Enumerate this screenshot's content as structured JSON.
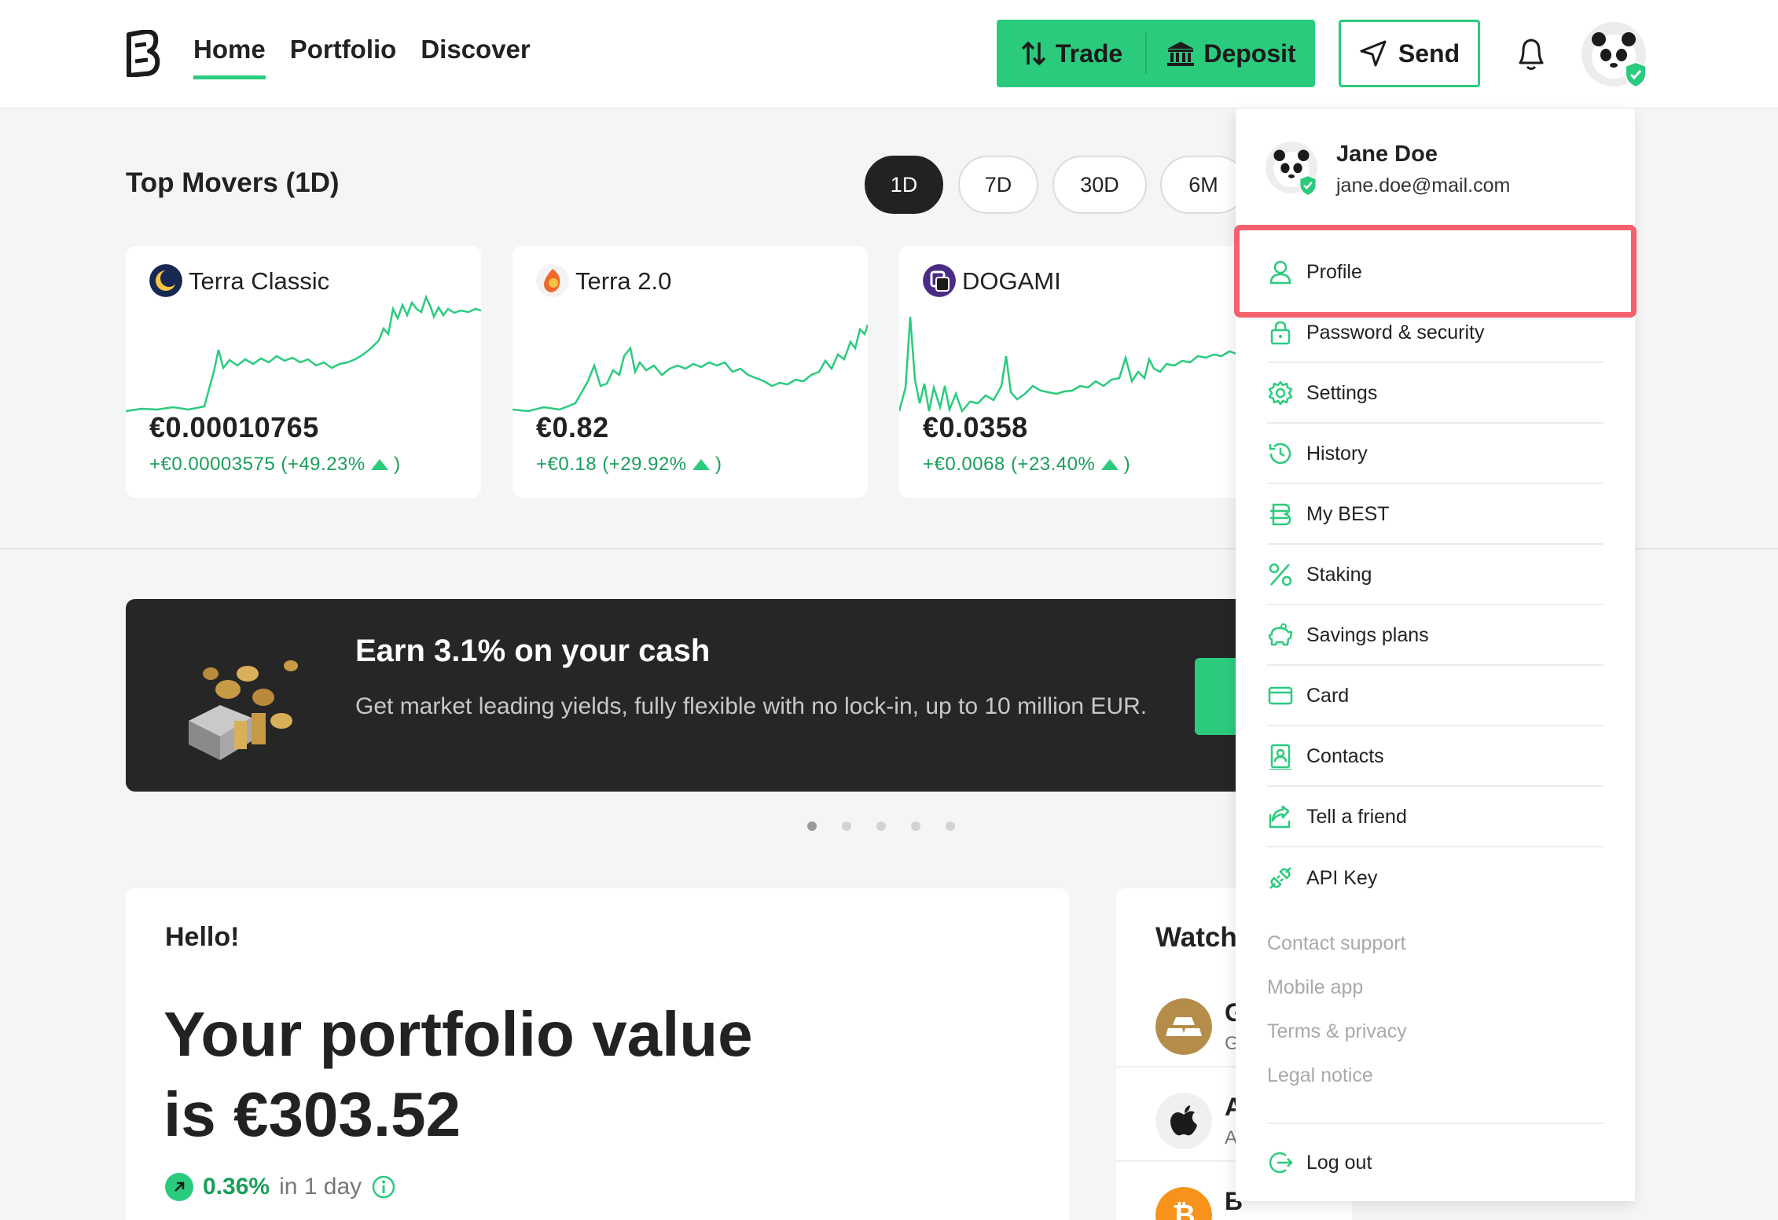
{
  "header": {
    "nav": [
      "Home",
      "Portfolio",
      "Discover"
    ],
    "trade_label": "Trade",
    "deposit_label": "Deposit",
    "send_label": "Send"
  },
  "top_movers": {
    "title": "Top Movers (1D)",
    "periods": [
      "1D",
      "7D",
      "30D",
      "6M"
    ],
    "active_period": "1D",
    "cards": [
      {
        "name": "Terra Classic",
        "price": "€0.00010765",
        "change": "+€0.00003575 (+49.23%",
        "close": ")"
      },
      {
        "name": "Terra 2.0",
        "price": "€0.82",
        "change": "+€0.18 (+29.92%",
        "close": ")"
      },
      {
        "name": "DOGAMI",
        "price": "€0.0358",
        "change": "+€0.0068 (+23.40%",
        "close": ")"
      }
    ]
  },
  "banner": {
    "title": "Earn 3.1% on your cash",
    "text": "Get market leading yields, fully flexible with no lock-in, up to 10 million EUR."
  },
  "portfolio": {
    "greeting": "Hello!",
    "line1": "Your portfolio value",
    "line2": "is €303.52",
    "change": "0.36%",
    "period": "in 1 day"
  },
  "watchlist": {
    "title": "Watch",
    "rows": [
      {
        "letter": "G",
        "sub": "G"
      },
      {
        "letter": "A",
        "sub": "A"
      },
      {
        "letter": "B",
        "sub": ""
      }
    ]
  },
  "dropdown": {
    "name": "Jane Doe",
    "email": "jane.doe@mail.com",
    "menu": [
      "Profile",
      "Password & security",
      "Settings",
      "History",
      "My BEST",
      "Staking",
      "Savings plans",
      "Card",
      "Contacts",
      "Tell a friend",
      "API Key"
    ],
    "links": [
      "Contact support",
      "Mobile app",
      "Terms & privacy",
      "Legal notice"
    ],
    "logout": "Log out"
  },
  "colors": {
    "accent": "#2bcb7e",
    "highlight": "#f4606c",
    "dark": "#262626"
  }
}
